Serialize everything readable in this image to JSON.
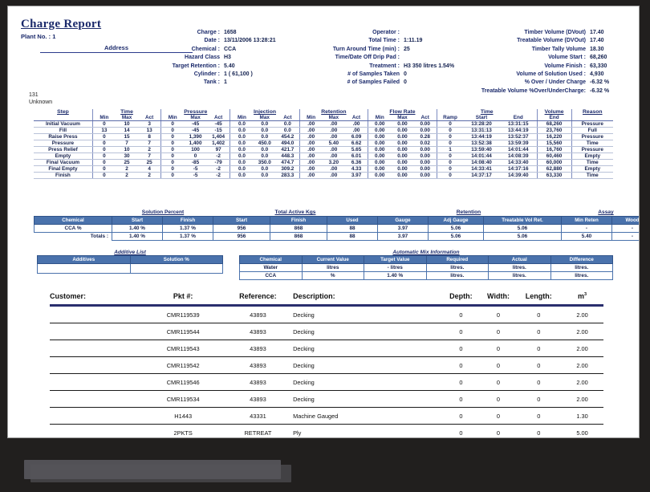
{
  "report": {
    "title": "Charge Report",
    "plant_label": "Plant No. :",
    "plant_value": "1",
    "address_label": "Address",
    "code_line1": "131",
    "code_line2": "Unknown"
  },
  "charge_info": [
    {
      "label": "Charge :",
      "value": "1658"
    },
    {
      "label": "Date :",
      "value": "13/11/2006  13:28:21"
    },
    {
      "label": "Chemical :",
      "value": "CCA"
    },
    {
      "label": "Hazard Class",
      "value": "H3"
    },
    {
      "label": "Target Retention :",
      "value": "5.40"
    },
    {
      "label": "Cylinder :",
      "value": "1        (  61,100  )"
    },
    {
      "label": "Tank :",
      "value": "1"
    }
  ],
  "operator_info": [
    {
      "label": "Operator :",
      "value": ""
    },
    {
      "label": "Total Time :",
      "value": "1:11.19"
    },
    {
      "label": "Turn Around Time  (min) :",
      "value": "25"
    },
    {
      "label": "Time/Date Off Drip Pad :",
      "value": ""
    },
    {
      "label": "Treatment :",
      "value": "H3 350 litres 1.54%"
    },
    {
      "label": "#  of Samples Taken",
      "value": "0"
    },
    {
      "label": "#  of Samples Failed",
      "value": "0"
    }
  ],
  "volume_info": [
    {
      "label": "Timber Volume (DVout)",
      "value": "17.40"
    },
    {
      "label": "Treatable Volume (DVOut)",
      "value": "17.40"
    },
    {
      "label": "Timber Tally Volume",
      "value": "18.30"
    },
    {
      "label": "Volume Start :",
      "value": "68,260"
    },
    {
      "label": "Volume Finish :",
      "value": "63,330"
    },
    {
      "label": "Volume of Solution Used :",
      "value": "4,930"
    },
    {
      "label": "% Over / Under Charge",
      "value": "-6.32 %"
    },
    {
      "label": "Treatable Volume %Over/UnderCharge:",
      "value": "-6.32 %"
    }
  ],
  "step_table": {
    "groups": [
      "Step",
      "Time",
      "Pressure",
      "Injection",
      "Retention",
      "Flow Rate",
      "Time",
      "Volume",
      "Reason"
    ],
    "subheaders": {
      "step": "",
      "time": [
        "Min",
        "Max",
        "Act"
      ],
      "pressure": [
        "Min",
        "Max",
        "Act"
      ],
      "injection": [
        "Min",
        "Max",
        "Act"
      ],
      "retention": [
        "Min",
        "Max",
        "Act"
      ],
      "flowrate": [
        "Min",
        "Max",
        "Act"
      ],
      "time2": [
        "Ramp",
        "Start",
        "End"
      ],
      "volume": [
        "End"
      ],
      "reason": [
        ""
      ]
    },
    "rows": [
      {
        "step": "Initial Vacuum",
        "t": [
          "0",
          "10",
          "3"
        ],
        "p": [
          "0",
          "-45",
          "-45"
        ],
        "i": [
          "0.0",
          "0.0",
          "0.0"
        ],
        "r": [
          ".00",
          ".00",
          ".00"
        ],
        "f": [
          "0.00",
          "0.00",
          "0.00"
        ],
        "ramp": "0",
        "start": "13:28:20",
        "end": "13:31:15",
        "vol": "68,260",
        "reason": "Pressure"
      },
      {
        "step": "Fill",
        "t": [
          "13",
          "14",
          "13"
        ],
        "p": [
          "0",
          "-45",
          "-15"
        ],
        "i": [
          "0.0",
          "0.0",
          "0.0"
        ],
        "r": [
          ".00",
          ".00",
          ".00"
        ],
        "f": [
          "0.00",
          "0.00",
          "0.00"
        ],
        "ramp": "0",
        "start": "13:31:13",
        "end": "13:44:19",
        "vol": "23,760",
        "reason": "Full"
      },
      {
        "step": "Raise Press",
        "t": [
          "0",
          "15",
          "8"
        ],
        "p": [
          "0",
          "1,390",
          "1,404"
        ],
        "i": [
          "0.0",
          "0.0",
          "454.2"
        ],
        "r": [
          ".00",
          ".00",
          "6.09"
        ],
        "f": [
          "0.00",
          "0.00",
          "0.28"
        ],
        "ramp": "0",
        "start": "13:44:19",
        "end": "13:52:37",
        "vol": "16,220",
        "reason": "Pressure"
      },
      {
        "step": "Pressure",
        "t": [
          "0",
          "7",
          "7"
        ],
        "p": [
          "0",
          "1,400",
          "1,402"
        ],
        "i": [
          "0.0",
          "450.0",
          "494.0"
        ],
        "r": [
          ".00",
          "5.40",
          "6.62"
        ],
        "f": [
          "0.00",
          "0.00",
          "0.02"
        ],
        "ramp": "0",
        "start": "13:52:38",
        "end": "13:59:39",
        "vol": "15,560",
        "reason": "Time"
      },
      {
        "step": "Press Relief",
        "t": [
          "0",
          "10",
          "2"
        ],
        "p": [
          "0",
          "100",
          "97"
        ],
        "i": [
          "0.0",
          "0.0",
          "421.7"
        ],
        "r": [
          ".00",
          ".00",
          "5.65"
        ],
        "f": [
          "0.00",
          "0.00",
          "0.00"
        ],
        "ramp": "1",
        "start": "13:59:40",
        "end": "14:01:44",
        "vol": "16,760",
        "reason": "Pressure"
      },
      {
        "step": "Empty",
        "t": [
          "0",
          "30",
          "7"
        ],
        "p": [
          "0",
          "0",
          "-2"
        ],
        "i": [
          "0.0",
          "0.0",
          "448.3"
        ],
        "r": [
          ".00",
          ".00",
          "6.01"
        ],
        "f": [
          "0.00",
          "0.00",
          "0.00"
        ],
        "ramp": "0",
        "start": "14:01:44",
        "end": "14:08:39",
        "vol": "60,460",
        "reason": "Empty"
      },
      {
        "step": "Final Vacuum",
        "t": [
          "0",
          "25",
          "25"
        ],
        "p": [
          "0",
          "-85",
          "-79"
        ],
        "i": [
          "0.0",
          "350.0",
          "474.7"
        ],
        "r": [
          ".00",
          "3.20",
          "6.36"
        ],
        "f": [
          "0.00",
          "0.00",
          "0.00"
        ],
        "ramp": "0",
        "start": "14:08:40",
        "end": "14:33:40",
        "vol": "60,000",
        "reason": "Time"
      },
      {
        "step": "Final Empty",
        "t": [
          "0",
          "2",
          "4"
        ],
        "p": [
          "0",
          "-5",
          "-2"
        ],
        "i": [
          "0.0",
          "0.0",
          "309.2"
        ],
        "r": [
          ".00",
          ".00",
          "4.33"
        ],
        "f": [
          "0.00",
          "0.00",
          "0.00"
        ],
        "ramp": "0",
        "start": "14:33:41",
        "end": "14:37:16",
        "vol": "62,880",
        "reason": "Empty"
      },
      {
        "step": "Finish",
        "t": [
          "0",
          "2",
          "2"
        ],
        "p": [
          "0",
          "-5",
          "-2"
        ],
        "i": [
          "0.0",
          "0.0",
          "283.3"
        ],
        "r": [
          ".00",
          ".00",
          "3.97"
        ],
        "f": [
          "0.00",
          "0.00",
          "0.00"
        ],
        "ramp": "0",
        "start": "14:37:17",
        "end": "14:39:40",
        "vol": "63,330",
        "reason": "Time"
      }
    ]
  },
  "solution": {
    "group_titles": [
      "Solution Percent",
      "Total Active Kgs",
      "Retention",
      "Assay"
    ],
    "headers": [
      "Chemical",
      "Start",
      "Finish",
      "Start",
      "Finish",
      "Used",
      "Gauge",
      "Adj Gauge",
      "Treatable Vol Ret.",
      "Min Reten",
      "Wood"
    ],
    "rows": [
      {
        "cells": [
          "CCA %",
          "1.40 %",
          "1.37 %",
          "956",
          "868",
          "88",
          "3.97",
          "5.06",
          "5.06",
          "-",
          "-"
        ]
      }
    ],
    "totals": {
      "label": "Totals :",
      "cells": [
        "1.40 %",
        "1.37 %",
        "956",
        "868",
        "88",
        "3.97",
        "5.06",
        "5.06",
        "5.40",
        "-"
      ]
    }
  },
  "additive": {
    "title": "Additive List",
    "headers": [
      "Additives",
      "Solution %"
    ],
    "rows": [
      {
        "cells": [
          "",
          ""
        ]
      }
    ]
  },
  "automix": {
    "title": "Automatic Mix Information",
    "headers": [
      "Chemical",
      "Current Value",
      "Target Value",
      "Required",
      "Actual",
      "Difference"
    ],
    "rows": [
      {
        "cells": [
          "Water",
          "litres",
          "-  litres",
          "litres.",
          "litres.",
          "litres."
        ]
      },
      {
        "cells": [
          "CCA",
          "%",
          "1.40 %",
          "litres.",
          "litres.",
          "litres."
        ]
      }
    ]
  },
  "customer_table": {
    "headers": [
      "Customer:",
      "Pkt #:",
      "Reference:",
      "Description:",
      "Depth:",
      "Width:",
      "Length:",
      "m"
    ],
    "header_sup": "3",
    "rows": [
      {
        "customer": "",
        "pkt": "CMR119539",
        "reference": "43893",
        "description": "Decking",
        "depth": "0",
        "width": "0",
        "length": "0",
        "m3": "2.00"
      },
      {
        "customer": "",
        "pkt": "CMR119544",
        "reference": "43893",
        "description": "Decking",
        "depth": "0",
        "width": "0",
        "length": "0",
        "m3": "2.00"
      },
      {
        "customer": "",
        "pkt": "CMR119543",
        "reference": "43893",
        "description": "Decking",
        "depth": "0",
        "width": "0",
        "length": "0",
        "m3": "2.00"
      },
      {
        "customer": "",
        "pkt": "CMR119542",
        "reference": "43893",
        "description": "Decking",
        "depth": "0",
        "width": "0",
        "length": "0",
        "m3": "2.00"
      },
      {
        "customer": "",
        "pkt": "CMR119546",
        "reference": "43893",
        "description": "Decking",
        "depth": "0",
        "width": "0",
        "length": "0",
        "m3": "2.00"
      },
      {
        "customer": "",
        "pkt": "CMR119534",
        "reference": "43893",
        "description": "Decking",
        "depth": "0",
        "width": "0",
        "length": "0",
        "m3": "2.00"
      },
      {
        "customer": "",
        "pkt": "H1443",
        "reference": "43331",
        "description": "Machine Gauged",
        "depth": "0",
        "width": "0",
        "length": "0",
        "m3": "1.30"
      },
      {
        "customer": "",
        "pkt": "2PKTS",
        "reference": "RETREAT",
        "description": "Ply",
        "depth": "0",
        "width": "0",
        "length": "0",
        "m3": "5.00"
      }
    ]
  },
  "colors": {
    "page_bg": "#ffffff",
    "desktop_bg": "#211f1e",
    "navy_text": "#1b2a6b",
    "table_header_blue": "#4a72ac",
    "rule_navy": "#2a2f6e"
  }
}
